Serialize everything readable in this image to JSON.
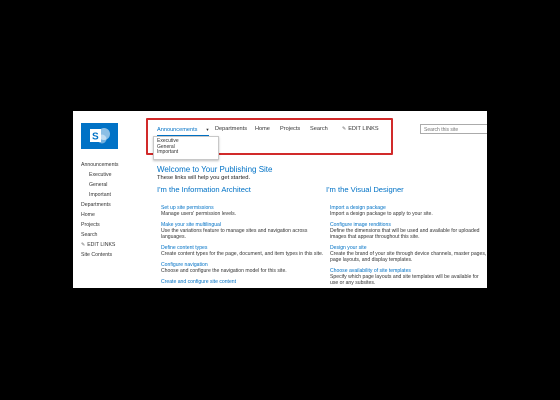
{
  "search": {
    "placeholder": "Search this site"
  },
  "topnav": {
    "items": [
      {
        "label": "Announcements"
      },
      {
        "label": "Departments"
      },
      {
        "label": "Home"
      },
      {
        "label": "Projects"
      },
      {
        "label": "Search"
      },
      {
        "label": "EDIT LINKS"
      }
    ],
    "dropdown": [
      "Executive",
      "General",
      "Important"
    ]
  },
  "leftnav": {
    "items": [
      "Announcements",
      "Executive",
      "General",
      "Important",
      "Departments",
      "Home",
      "Projects",
      "Search",
      "EDIT LINKS",
      "Site Contents"
    ]
  },
  "main": {
    "title": "Welcome to Your Publishing Site",
    "subtitle": "These links will help you get started.",
    "col1": {
      "heading": "I'm the Information Architect",
      "items": [
        {
          "title": "Set up site permissions",
          "desc": "Manage users' permission levels."
        },
        {
          "title": "Make your site multilingual",
          "desc": "Use the variations feature to manage sites and navigation across languages."
        },
        {
          "title": "Define content types",
          "desc": "Create content types for the page, document, and item types in this site."
        },
        {
          "title": "Configure navigation",
          "desc": "Choose and configure the navigation model for this site."
        },
        {
          "title": "Create and configure site content",
          "desc": ""
        }
      ]
    },
    "col2": {
      "heading": "I'm the Visual Designer",
      "items": [
        {
          "title": "Import a design package",
          "desc": "Import a design package to apply to your site."
        },
        {
          "title": "Configure image renditions",
          "desc": "Define the dimensions that will be used and available for uploaded images that appear throughout this site."
        },
        {
          "title": "Design your site",
          "desc": "Create the brand of your site through device channels, master pages, page layouts, and display templates."
        },
        {
          "title": "Choose availability of site templates",
          "desc": "Specify which page layouts and site templates will be available for use or any subsites."
        }
      ]
    }
  }
}
